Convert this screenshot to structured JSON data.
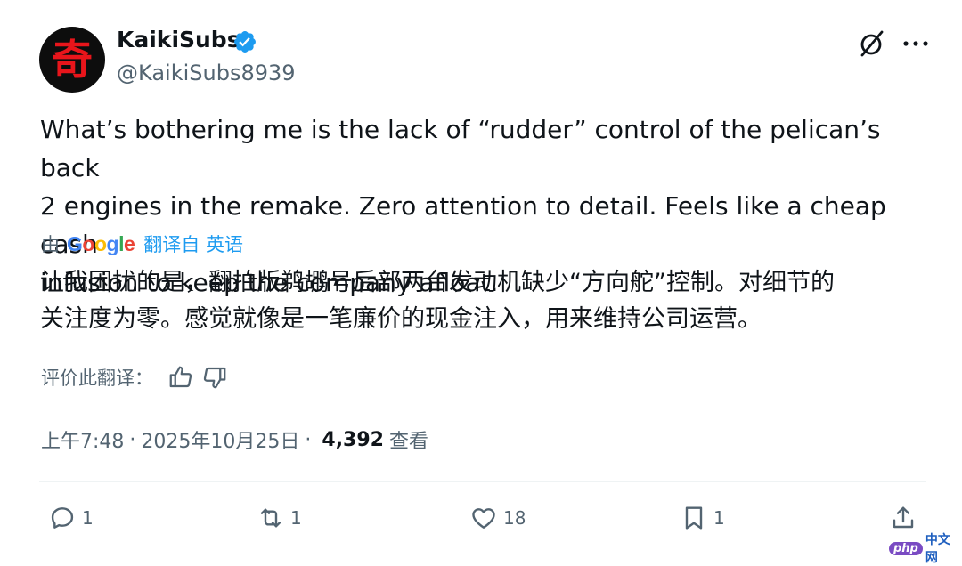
{
  "author": {
    "avatar_glyph": "奇",
    "display_name": "KaikiSubs",
    "handle": "@KaikiSubs8939",
    "verified": true,
    "verified_color": "#1d9bf0"
  },
  "header_actions": {
    "grok_icon": "grok-icon",
    "more_icon": "more-icon"
  },
  "tweet": {
    "text": "What’s bothering me is the lack of “rudder” control of the pelican’s back\n2 engines in the remake. Zero attention to detail. Feels like a cheap cash\ninfusion to keep the company afloat."
  },
  "translation": {
    "prefix": "由",
    "provider": [
      "G",
      "o",
      "o",
      "g",
      "l",
      "e"
    ],
    "translated_from": "翻译自 英语",
    "text": "让我困扰的是，翻拍版鹈鹕号后部两台发动机缺少“方向舵”控制。对细节的\n关注度为零。感觉就像是一笔廉价的现金注入，用来维持公司运营。",
    "rate_label": "评价此翻译：",
    "link_color": "#1d9bf0"
  },
  "meta": {
    "time": "上午7:48",
    "separator": "·",
    "date": "2025年10月25日",
    "views_count": "4,392",
    "views_label": "查看"
  },
  "actions": {
    "replies": "1",
    "reposts": "1",
    "likes": "18",
    "bookmarks": "1"
  },
  "watermark": {
    "badge": "php",
    "text": "中文网"
  },
  "colors": {
    "text_primary": "#0f1419",
    "text_secondary": "#536471",
    "divider": "#eff3f4"
  }
}
